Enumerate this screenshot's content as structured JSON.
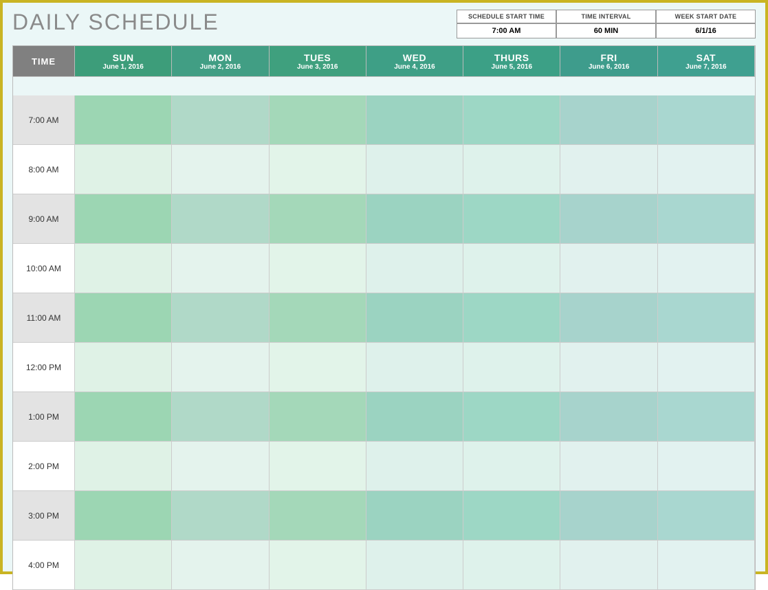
{
  "title": "DAILY SCHEDULE",
  "meta": {
    "labels": {
      "start_time": "SCHEDULE START TIME",
      "interval": "TIME INTERVAL",
      "week_start": "WEEK START DATE"
    },
    "values": {
      "start_time": "7:00 AM",
      "interval": "60 MIN",
      "week_start": "6/1/16"
    }
  },
  "time_header": "TIME",
  "days": [
    {
      "name": "SUN",
      "date": "June 1, 2016"
    },
    {
      "name": "MON",
      "date": "June 2, 2016"
    },
    {
      "name": "TUES",
      "date": "June 3, 2016"
    },
    {
      "name": "WED",
      "date": "June 4, 2016"
    },
    {
      "name": "THURS",
      "date": "June 5, 2016"
    },
    {
      "name": "FRI",
      "date": "June 6, 2016"
    },
    {
      "name": "SAT",
      "date": "June 7, 2016"
    }
  ],
  "times": [
    "7:00 AM",
    "8:00 AM",
    "9:00 AM",
    "10:00 AM",
    "11:00 AM",
    "12:00 PM",
    "1:00 PM",
    "2:00 PM",
    "3:00 PM",
    "4:00 PM"
  ]
}
